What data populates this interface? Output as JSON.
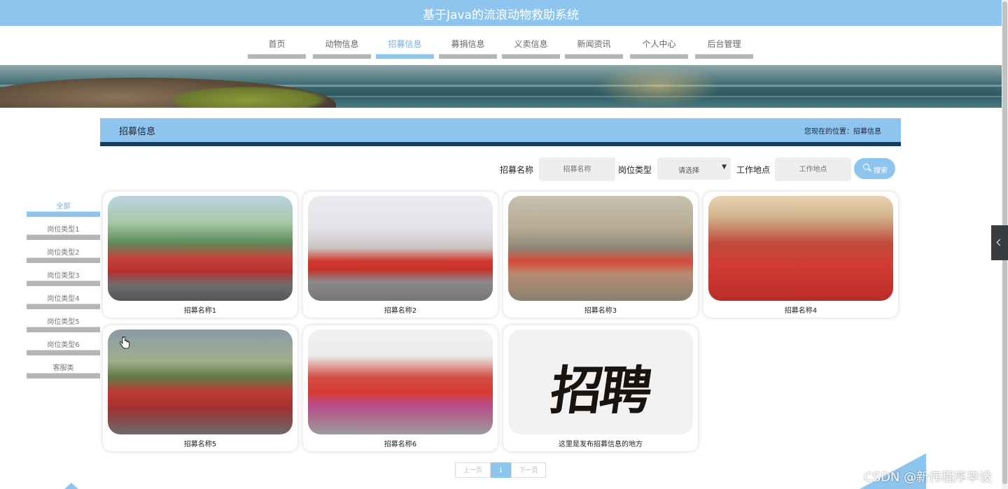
{
  "site": {
    "title": "基于Java的流浪动物救助系统"
  },
  "nav": {
    "items": [
      {
        "label": "首页",
        "active": false
      },
      {
        "label": "动物信息",
        "active": false
      },
      {
        "label": "招募信息",
        "active": true
      },
      {
        "label": "募捐信息",
        "active": false
      },
      {
        "label": "义卖信息",
        "active": false
      },
      {
        "label": "新闻资讯",
        "active": false
      },
      {
        "label": "个人中心",
        "active": false
      },
      {
        "label": "后台管理",
        "active": false
      }
    ]
  },
  "section": {
    "title": "招募信息",
    "location": "您现在的位置：招募信息"
  },
  "search": {
    "name_label": "招募名称",
    "name_placeholder": "招募名称",
    "type_label": "岗位类型",
    "type_value": "请选择",
    "place_label": "工作地点",
    "place_placeholder": "工作地点",
    "button_label": "搜索"
  },
  "categories": [
    {
      "label": "全部",
      "active": true
    },
    {
      "label": "岗位类型1",
      "active": false
    },
    {
      "label": "岗位类型2",
      "active": false
    },
    {
      "label": "岗位类型3",
      "active": false
    },
    {
      "label": "岗位类型4",
      "active": false
    },
    {
      "label": "岗位类型5",
      "active": false
    },
    {
      "label": "岗位类型6",
      "active": false
    },
    {
      "label": "客服类",
      "active": false
    }
  ],
  "cards": [
    {
      "caption": "招募名称1"
    },
    {
      "caption": "招募名称2"
    },
    {
      "caption": "招募名称3"
    },
    {
      "caption": "招募名称4"
    },
    {
      "caption": "招募名称5"
    },
    {
      "caption": "招募名称6"
    },
    {
      "caption": "这里是发布招募信息的地方",
      "image_text": "招聘"
    }
  ],
  "pagination": {
    "prev": "上一页",
    "current": "1",
    "next": "下一页"
  },
  "watermark": "CSDN @新伟程序毕设",
  "colors": {
    "accent": "#8ec5ef",
    "dark_bar": "#163d5c"
  }
}
